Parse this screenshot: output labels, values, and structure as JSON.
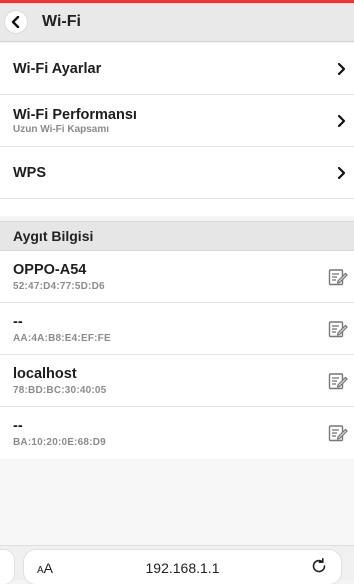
{
  "header": {
    "title": "Wi-Fi"
  },
  "wifi_settings": [
    {
      "label": "Wi-Fi Ayarlar",
      "sublabel": ""
    },
    {
      "label": "Wi-Fi Performansı",
      "sublabel": "Uzun Wi-Fi Kapsamı"
    },
    {
      "label": "WPS",
      "sublabel": ""
    }
  ],
  "device_section": {
    "title": "Aygıt Bilgisi",
    "devices": [
      {
        "name": "OPPO-A54",
        "mac": "52:47:D4:77:5D:D6"
      },
      {
        "name": "--",
        "mac": "AA:4A:B8:E4:EF:FE"
      },
      {
        "name": "localhost",
        "mac": "78:BD:BC:30:40:05"
      },
      {
        "name": "--",
        "mac": "BA:10:20:0E:68:D9"
      }
    ]
  },
  "browser": {
    "text_size_big": "A",
    "text_size_small": "A",
    "url": "192.168.1.1"
  },
  "icons": {
    "back": "chevron-left-icon",
    "row": "chevron-right-icon",
    "edit": "edit-icon",
    "reload": "reload-icon"
  },
  "colors": {
    "accent": "#e53935"
  }
}
